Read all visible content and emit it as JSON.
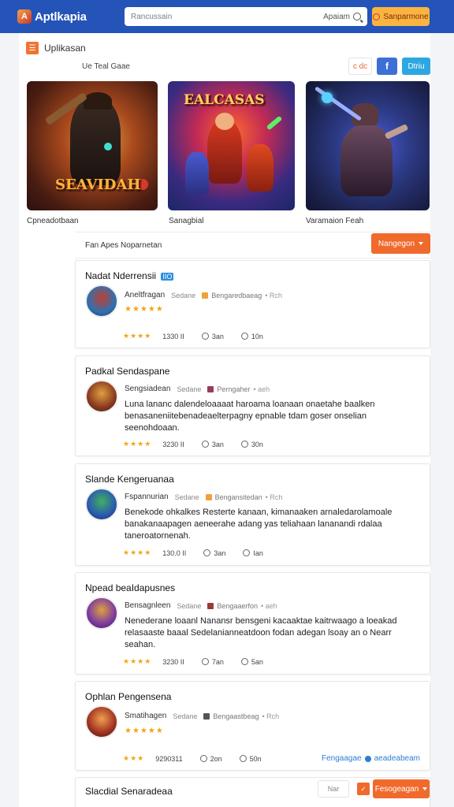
{
  "header": {
    "logo_text": "Aptlkapia",
    "logo_glyph": "A",
    "search_placeholder": "Rancussain",
    "search_scope": "Apaiam",
    "cta_label": "Sanparmone"
  },
  "breadcrumb": {
    "icon_glyph": "☰",
    "label": "Uplikasan"
  },
  "filter": {
    "label": "Ue   Teal Gaae",
    "chip_orange": "c dc",
    "chip_fb": "f",
    "chip_tw": "Dtriu"
  },
  "gallery": [
    {
      "caption": "Cpneadotbaan",
      "title": "SEAVIDAH"
    },
    {
      "caption": "Sanagbial",
      "title": "EALCASAS"
    },
    {
      "caption": "Varamaion Feah",
      "title": ""
    }
  ],
  "sort": {
    "label": "Fan   Apes Noparnetan",
    "button": "Nangegon"
  },
  "cards": [
    {
      "title": "Nadat  Nderrensii",
      "badge": "IIO",
      "author": "Aneltfragan",
      "sub": "Sedane",
      "tag": "Bengaredbaeag",
      "dot": "• Rch",
      "stars": "★★★★★",
      "desc": "",
      "stats_stars": "★★★★",
      "stat_1": "1330 II",
      "stat_2": "3an",
      "stat_3": "10n"
    },
    {
      "title": "Padkal Sendaspane",
      "badge": "",
      "author": "Sengsiadean",
      "sub": "Sedane",
      "tag": "Perngaher",
      "dot": "• aeh",
      "stars": "",
      "desc": "Luna lananc dalendeloaaaat haroama loanaan onaetahe baalken benasaneniitebenadeaelterpagny epnable tdam goser onselian seenohdoaan.",
      "stats_stars": "★★★★",
      "stat_1": "3230 II",
      "stat_2": "3an",
      "stat_3": "30n"
    },
    {
      "title": "Slande Kengeruanaa",
      "badge": "",
      "author": "Fspannurian",
      "sub": "Sedane",
      "tag": "Bengansitedan",
      "dot": "• Rch",
      "stars": "",
      "desc": "Benekode ohkalkes Resterte kanaan, kimanaaken arnaledarolamoale banakanaapagen aeneerahe adang yas teliahaan lananandi rdalaa taneroatornenah.",
      "stats_stars": "★★★★",
      "stat_1": "130.0 II",
      "stat_2": "3an",
      "stat_3": "Ian"
    },
    {
      "title": "Npead beaIdapusnes",
      "badge": "",
      "author": "Bensagnleen",
      "sub": "Sedane",
      "tag": "Bengaaerfon",
      "dot": "• aeh",
      "stars": "",
      "desc": "Nenederane loaanl Nanansr bensgeni kacaaktae kaitrwaago a loeakad relasaaste baaal Sedelanianneatdoon fodan adegan lsoay an o Nearr seahan.",
      "stats_stars": "★★★★",
      "stat_1": "3230 II",
      "stat_2": "7an",
      "stat_3": "5an"
    },
    {
      "title": "Ophlan Pengensena",
      "badge": "",
      "author": "Smatihagen",
      "sub": "Sedane",
      "tag": "Bengaastbeag",
      "dot": "• Rch",
      "stars": "★★★★★",
      "desc": "",
      "stats_stars": "★★★",
      "stat_1": "9290311",
      "stat_2": "2on",
      "stat_3": "50n",
      "link_1": "Fengaagae",
      "link_2": "aeadeabeam"
    },
    {
      "title": "Slacdial Senaradeaa",
      "badge": "",
      "author": "",
      "chip": "Nar",
      "button": "Fesogeagan"
    }
  ]
}
